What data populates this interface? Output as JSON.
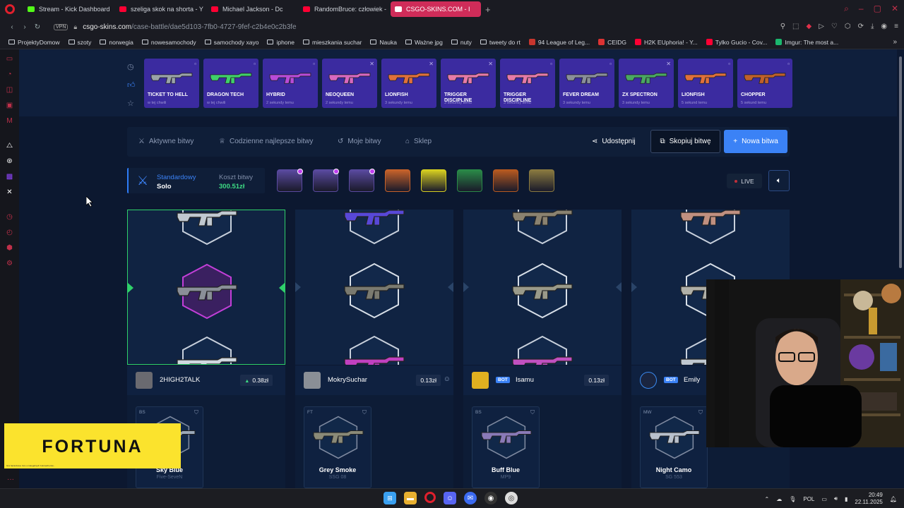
{
  "browser": {
    "tabs": [
      {
        "label": "Stream - Kick Dashboard",
        "color": "#53fc18"
      },
      {
        "label": "szeliga skok na shorta - Y",
        "color": "#ff0033"
      },
      {
        "label": "Michael Jackson - Dc",
        "color": "#ff0033"
      },
      {
        "label": "RandomBruce: człowiek -",
        "color": "#ff0033"
      },
      {
        "label": "CSGO-SKINS.COM - I",
        "color": "#ffffff"
      }
    ],
    "vpn_label": "VPN",
    "url_host": "csgo-skins.com",
    "url_path": "/case-battle/dae5d103-7fb0-4727-9fef-c2b4e0c2b3fe",
    "bookmarks": [
      {
        "label": "ProjektyDomow",
        "type": "folder"
      },
      {
        "label": "szoty",
        "type": "folder"
      },
      {
        "label": "norwegia",
        "type": "folder"
      },
      {
        "label": "nowesamochody",
        "type": "folder"
      },
      {
        "label": "samochody xayo",
        "type": "folder"
      },
      {
        "label": "iphone",
        "type": "folder"
      },
      {
        "label": "mieszkania suchar",
        "type": "folder"
      },
      {
        "label": "Nauka",
        "type": "folder"
      },
      {
        "label": "Ważne jpg",
        "type": "folder"
      },
      {
        "label": "nuty",
        "type": "folder"
      },
      {
        "label": "tweety do rt",
        "type": "folder"
      },
      {
        "label": "94 League of Leg...",
        "type": "site",
        "color": "#c8362e"
      },
      {
        "label": "CEIDG",
        "type": "site",
        "color": "#d33"
      },
      {
        "label": "H2K EUphoria! - Y...",
        "type": "site",
        "color": "#ff0033"
      },
      {
        "label": "Tylko Gucio - Cov...",
        "type": "site",
        "color": "#ff0033"
      },
      {
        "label": "Imgur: The most a...",
        "type": "site",
        "color": "#1bb76e"
      }
    ]
  },
  "live_drops": [
    {
      "name": "TICKET TO HELL",
      "time": "w tej chwili",
      "gun": "#9aa3a8"
    },
    {
      "name": "DRAGON TECH",
      "time": "w tej chwili",
      "gun": "#3fd06a"
    },
    {
      "name": "HYBRID",
      "time": "2 sekundy temu",
      "gun": "#b84bd8"
    },
    {
      "name": "NEOQUEEN",
      "time": "2 sekundy temu",
      "gun": "#d868c0"
    },
    {
      "name": "LIONFISH",
      "time": "3 sekundy temu",
      "gun": "#e0703a"
    },
    {
      "name": "TRIGGER DISCIPLINE",
      "time": "3 sekundy temu",
      "gun": "#e67aa8"
    },
    {
      "name": "TRIGGER DISCIPLINE",
      "time": "3 sekundy temu",
      "gun": "#e67aa8"
    },
    {
      "name": "FEVER DREAM",
      "time": "3 sekundy temu",
      "gun": "#8a8f9a"
    },
    {
      "name": "ZX SPECTRON",
      "time": "3 sekundy temu",
      "gun": "#49a862"
    },
    {
      "name": "LIONFISH",
      "time": "5 sekund temu",
      "gun": "#e0703a"
    },
    {
      "name": "CHOPPER",
      "time": "5 sekund temu",
      "gun": "#c0602a"
    }
  ],
  "menu": {
    "active": "Aktywne bitwy",
    "daily": "Codzienne najlepsze bitwy",
    "mine": "Moje bitwy",
    "shop": "Sklep",
    "share": "Udostępnij",
    "copy": "Skopiuj bitwę",
    "new": "Nowa bitwa"
  },
  "battle": {
    "mode": "Standardowy",
    "sub": "Solo",
    "cost_label": "Koszt bitwy",
    "cost_value": "300.51zł",
    "cases": [
      {
        "color": "#5a4aa0",
        "badge": true
      },
      {
        "color": "#5a4aa0",
        "badge": true
      },
      {
        "color": "#5a4aa0",
        "badge": true
      },
      {
        "color": "#c8622a",
        "badge": false
      },
      {
        "color": "#d8d020",
        "badge": false
      },
      {
        "color": "#2a8a48",
        "badge": false
      },
      {
        "color": "#b85a20",
        "badge": false
      },
      {
        "color": "#8a7a40",
        "badge": false
      }
    ],
    "live_label": "LIVE"
  },
  "players": [
    {
      "name": "2HIGH2TALK",
      "value": "0.38zł",
      "bot": false,
      "up": true,
      "item_cond": "BS",
      "item_name": "Sky Blue",
      "item_gun": "Five-SeveN",
      "avatar": "#6a6a70"
    },
    {
      "name": "MokrySuchar",
      "value": "0.13zł",
      "bot": false,
      "up": false,
      "item_cond": "FT",
      "item_name": "Grey Smoke",
      "item_gun": "SSG 08",
      "avatar": "#8a8f96"
    },
    {
      "name": "Isamu",
      "value": "0.13zł",
      "bot": true,
      "up": false,
      "item_cond": "BS",
      "item_name": "Buff Blue",
      "item_gun": "MP9",
      "avatar": "#e0b020"
    },
    {
      "name": "Emily",
      "value": "",
      "bot": true,
      "up": false,
      "item_cond": "MW",
      "item_name": "Night Camo",
      "item_gun": "SG 553",
      "avatar": "#1a2540"
    }
  ],
  "bot_label": "BOT",
  "fortuna": {
    "brand": "FORTUNA",
    "fine": "Gra hazardowa. Gra u nielegalnych bukmacherów..."
  },
  "taskbar": {
    "lang": "POL",
    "time": "20:49",
    "date": "22.11.2025"
  }
}
